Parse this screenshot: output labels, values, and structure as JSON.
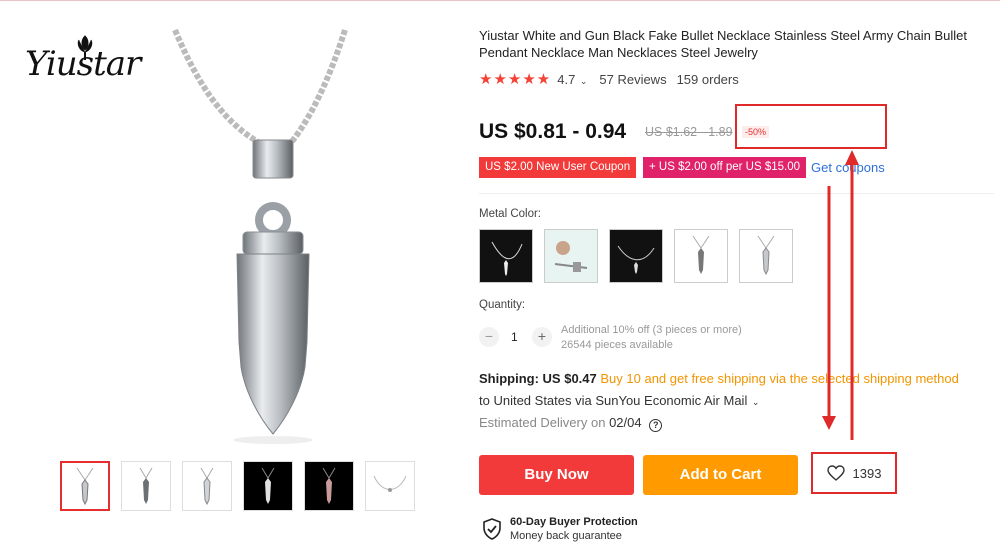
{
  "brand": {
    "logo_text": "Yiustar"
  },
  "product": {
    "title": "Yiustar White and Gun Black Fake Bullet Necklace Stainless Steel Army Chain Bullet Pendant Necklace Man Necklaces Steel Jewelry",
    "rating_stars": "★★★★★",
    "rating": "4.7",
    "reviews": "57 Reviews",
    "orders": "159 orders",
    "rating_value": 4.7
  },
  "pricing": {
    "price": "US $0.81 - 0.94",
    "original_price": "US $1.62 - 1.89",
    "discount": "-50%"
  },
  "coupons": {
    "new_user": "US $2.00 New User Coupon",
    "spend_save": "+ US $2.00 off per US $15.00",
    "get_coupons": "Get coupons"
  },
  "variants": {
    "label": "Metal Color:",
    "count": 5
  },
  "quantity": {
    "label": "Quantity:",
    "value": "1",
    "minus": "−",
    "plus": "+",
    "note_line1": "Additional 10% off (3 pieces or more)",
    "note_line2": "26544 pieces available"
  },
  "shipping": {
    "label": "Shipping: US $0.47",
    "promo": "Buy 10 and get free shipping via the selected shipping method",
    "destination": "to United States via SunYou Economic Air Mail",
    "delivery_label": "Estimated Delivery on",
    "delivery_date": "02/04",
    "help": "?"
  },
  "actions": {
    "buy_now": "Buy Now",
    "add_to_cart": "Add to Cart",
    "wishlist_count": "1393"
  },
  "protection": {
    "title": "60-Day Buyer Protection",
    "subtitle": "Money back guarantee"
  },
  "colors": {
    "accent_red": "#f23a3a",
    "accent_orange": "#ff9a00",
    "coupon_pink": "#e0226a",
    "link_blue": "#2e6fd9",
    "star_red": "#f44336"
  },
  "icons": [
    "heart-icon",
    "shield-check-icon",
    "help-icon",
    "chevron-down-icon"
  ]
}
